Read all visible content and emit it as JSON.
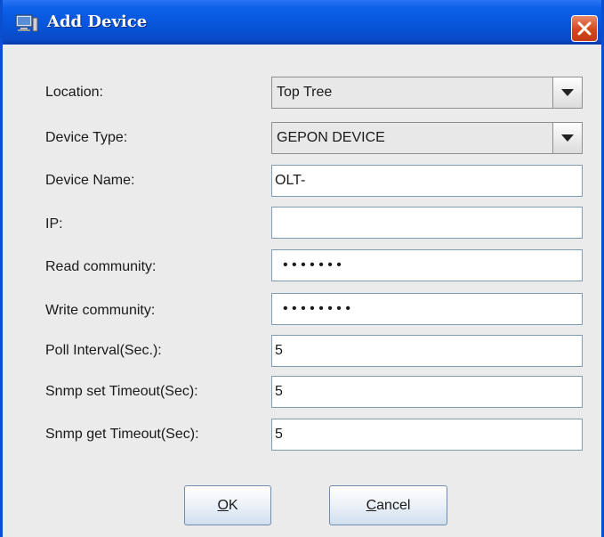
{
  "window": {
    "title": "Add Device",
    "title_icon": "computer-icon",
    "close_icon": "close-icon"
  },
  "form": {
    "location": {
      "label": "Location:",
      "value": "Top Tree"
    },
    "device_type": {
      "label": "Device Type:",
      "value": "GEPON DEVICE"
    },
    "device_name": {
      "label": "Device Name:",
      "value": "OLT-"
    },
    "ip": {
      "label": "IP:",
      "value": ""
    },
    "read_community": {
      "label": "Read community:",
      "value": "• • • • • • •"
    },
    "write_community": {
      "label": "Write community:",
      "value": "• • • • • • • •"
    },
    "poll_interval": {
      "label": "Poll Interval(Sec.):",
      "value": "5"
    },
    "snmp_set_timeout": {
      "label": "Snmp set Timeout(Sec):",
      "value": "5"
    },
    "snmp_get_timeout": {
      "label": "Snmp get Timeout(Sec):",
      "value": "5"
    }
  },
  "buttons": {
    "ok": {
      "mnemonic": "O",
      "rest": "K"
    },
    "cancel": {
      "mnemonic": "C",
      "rest": "ancel"
    }
  },
  "colors": {
    "title_bar": "#0854d8",
    "dialog_bg": "#ebebeb",
    "close_button": "#d5461d"
  }
}
